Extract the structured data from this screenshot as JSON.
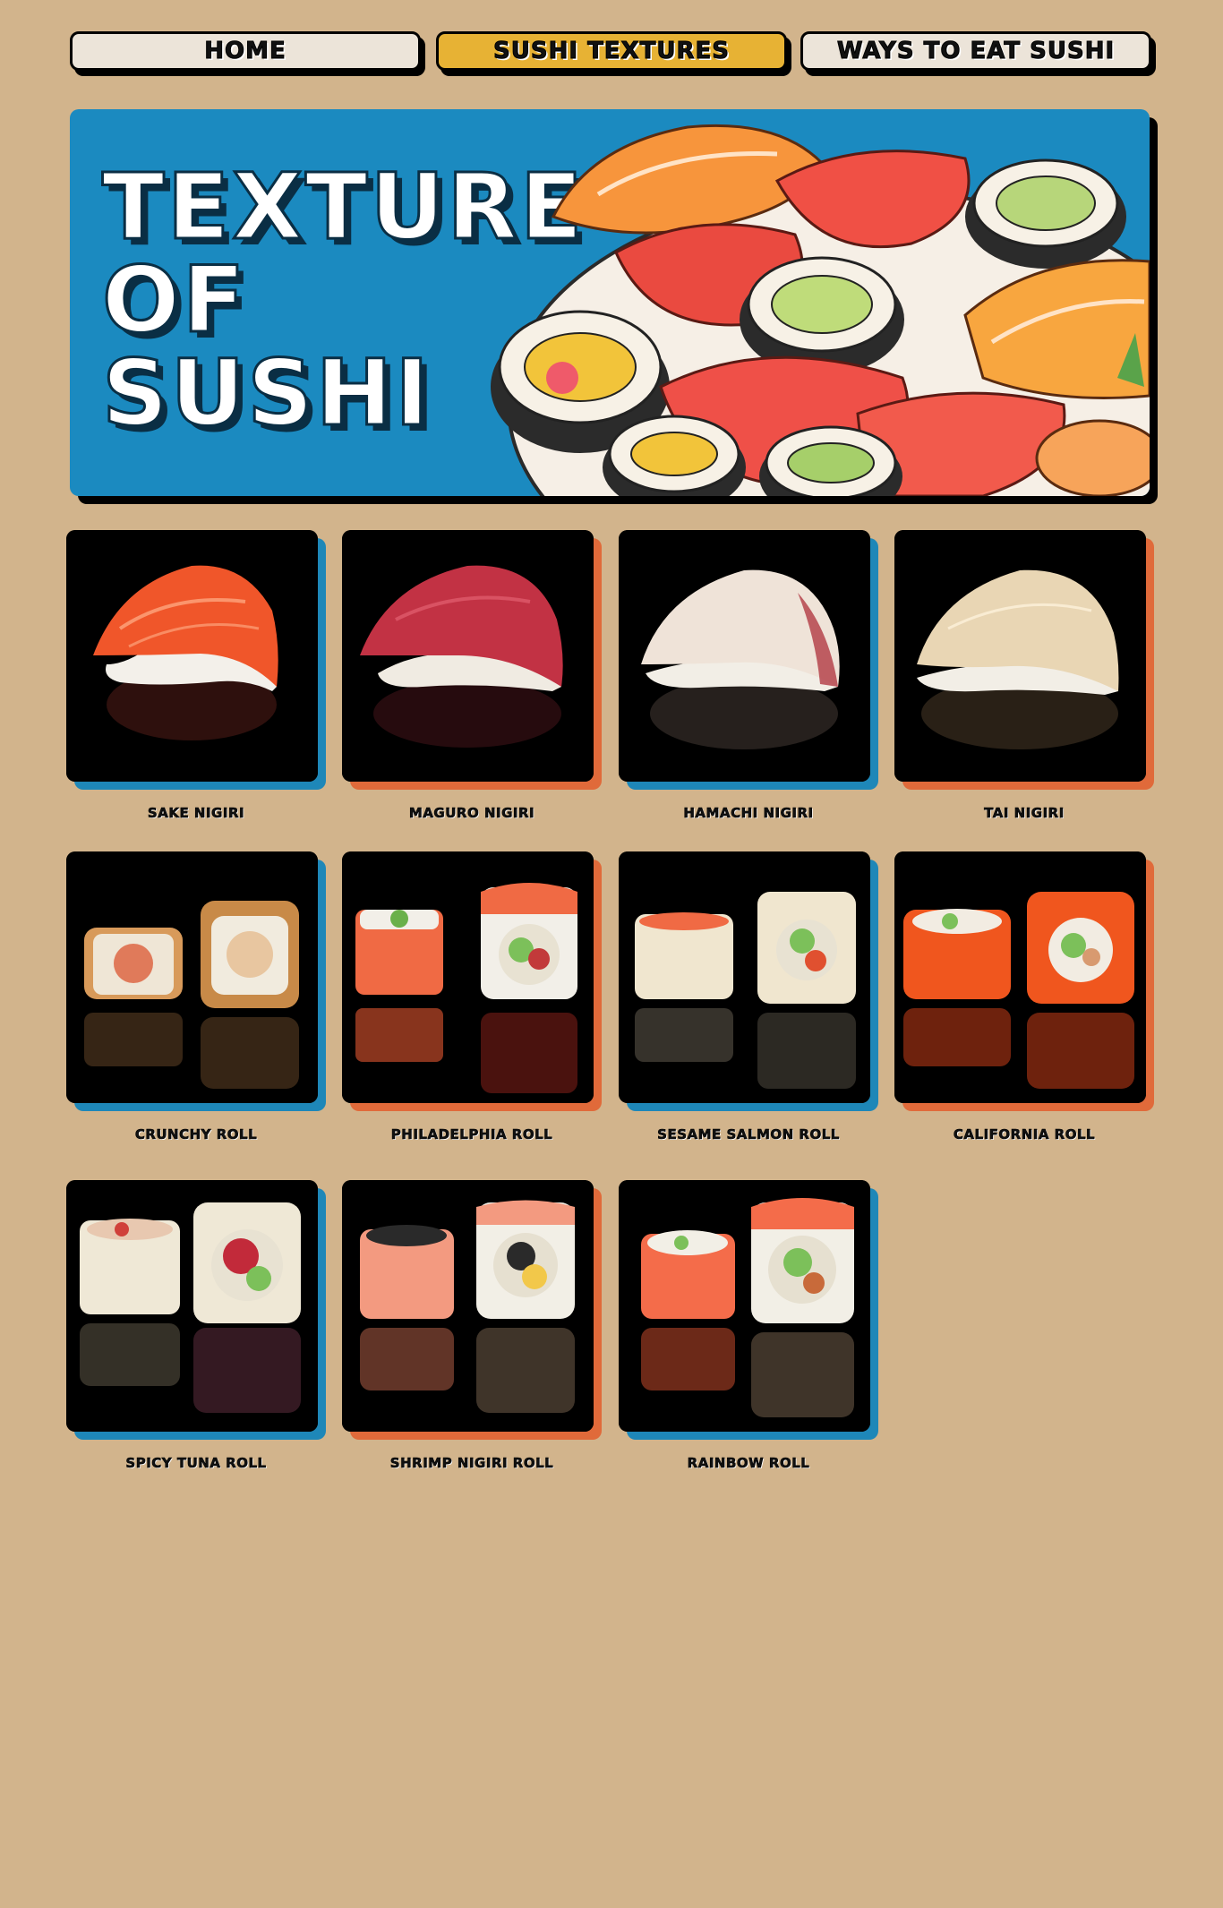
{
  "nav": {
    "items": [
      {
        "label": "HOME",
        "active": false
      },
      {
        "label": "SUSHI TEXTURES",
        "active": true
      },
      {
        "label": "WAYS TO EAT SUSHI",
        "active": false
      }
    ]
  },
  "hero": {
    "title_line1": "TEXTURE",
    "title_line2": "OF",
    "title_line3": "SUSHI"
  },
  "colors": {
    "background": "#d2b48c",
    "hero_blue": "#1b8ac0",
    "nav_active": "#e7b234",
    "nav_plain": "#ece4d9",
    "shadow_blue": "#1e87b8",
    "shadow_orange": "#e06a3a"
  },
  "sushi": [
    {
      "name": "SAKE NIGIRI",
      "kind": "nigiri",
      "fish": "#f0562a",
      "accent": "blue"
    },
    {
      "name": "MAGURO NIGIRI",
      "kind": "nigiri",
      "fish": "#c23244",
      "accent": "orange"
    },
    {
      "name": "HAMACHI NIGIRI",
      "kind": "nigiri",
      "fish": "#efe3d8",
      "accent": "blue"
    },
    {
      "name": "TAI NIGIRI",
      "kind": "nigiri",
      "fish": "#e9d6b4",
      "accent": "orange"
    },
    {
      "name": "CRUNCHY ROLL",
      "kind": "roll",
      "fish": "#d89a5a",
      "accent": "blue"
    },
    {
      "name": "PHILADELPHIA ROLL",
      "kind": "roll",
      "fish": "#f06a44",
      "accent": "orange"
    },
    {
      "name": "SESAME SALMON ROLL",
      "kind": "roll",
      "fish": "#f0e6cf",
      "accent": "blue"
    },
    {
      "name": "CALIFORNIA ROLL",
      "kind": "roll",
      "fish": "#f0561e",
      "accent": "orange"
    },
    {
      "name": "SPICY TUNA ROLL",
      "kind": "roll",
      "fish": "#efe8d6",
      "accent": "blue"
    },
    {
      "name": "SHRIMP NIGIRI ROLL",
      "kind": "roll",
      "fish": "#f39a80",
      "accent": "orange"
    },
    {
      "name": "RAINBOW ROLL",
      "kind": "roll",
      "fish": "#f46c4a",
      "accent": "blue"
    }
  ]
}
